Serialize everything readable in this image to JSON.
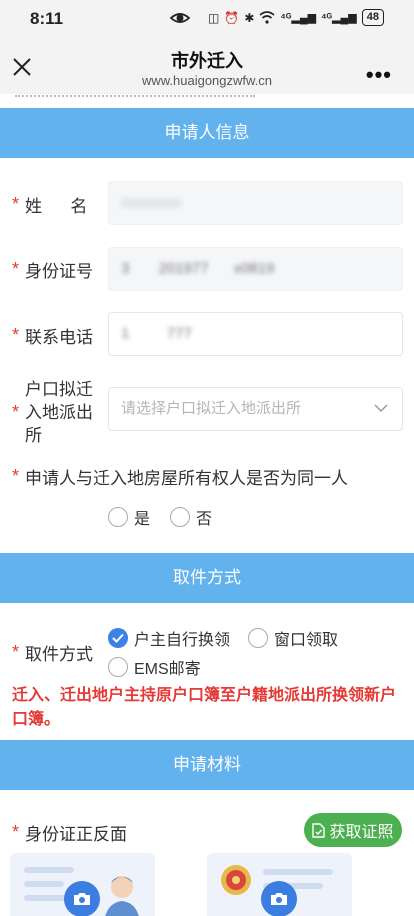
{
  "status_bar": {
    "time": "8:11",
    "battery": "48"
  },
  "nav": {
    "title": "市外迁入",
    "url": "www.huaigongzwfw.cn"
  },
  "sections": {
    "applicant": "申请人信息",
    "pickup": "取件方式",
    "materials": "申请材料"
  },
  "form": {
    "name_label": "姓      名",
    "name_value": "",
    "id_label": "身份证号",
    "id_value": "3       201977      x0819",
    "phone_label": "联系电话",
    "phone_value": "1         777",
    "police_label": "户口拟迁入地派出所",
    "police_placeholder": "请选择户口拟迁入地派出所",
    "same_owner_question": "申请人与迁入地房屋所有权人是否为同一人",
    "yes": "是",
    "no": "否"
  },
  "pickup": {
    "label": "取件方式",
    "options": [
      "户主自行换领",
      "窗口领取",
      "EMS邮寄"
    ],
    "selected": "户主自行换领",
    "note": "迁入、迁出地户主持原户口簿至户籍地派出所换领新户口簿。"
  },
  "materials": {
    "id_card_label": "身份证正反面",
    "get_cert_button": "获取证照"
  },
  "colors": {
    "header_blue": "#62b2ee",
    "required_red": "#e53935",
    "green": "#4caf50",
    "check_blue": "#3b82e6"
  }
}
